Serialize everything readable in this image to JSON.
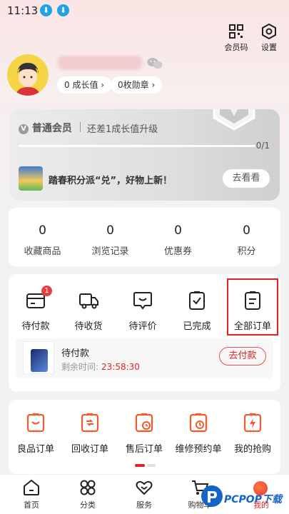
{
  "status_bar": {
    "time": "11:13"
  },
  "header": {
    "member_code_label": "会员码",
    "settings_label": "设置"
  },
  "profile": {
    "growth_chip": "0 成长值 ›",
    "medal_chip": "0枚勋章 ›"
  },
  "member_card": {
    "level": "普通会员",
    "upgrade_text": "还差1成长值升级",
    "progress_text": "0/1",
    "progress_value": 0,
    "promo_text": "踏春积分派“兑”，好物上新！",
    "promo_button": "去看看"
  },
  "stats": [
    {
      "value": "0",
      "label": "收藏商品"
    },
    {
      "value": "0",
      "label": "浏览记录"
    },
    {
      "value": "0",
      "label": "优惠券"
    },
    {
      "value": "0",
      "label": "积分"
    }
  ],
  "orders": {
    "items": [
      {
        "label": "待付款",
        "badge": "1",
        "icon": "wallet-icon"
      },
      {
        "label": "待收货",
        "icon": "truck-icon"
      },
      {
        "label": "待评价",
        "icon": "comment-icon"
      },
      {
        "label": "已完成",
        "icon": "check-clipboard-icon"
      },
      {
        "label": "全部订单",
        "icon": "list-clipboard-icon"
      }
    ],
    "pending": {
      "title": "待付款",
      "remaining_label": "剩余时间:",
      "remaining_time": "23:58:30",
      "pay_button": "去付款"
    }
  },
  "services": [
    {
      "label": "良品订单",
      "icon": "good-order-icon"
    },
    {
      "label": "回收订单",
      "icon": "recycle-order-icon"
    },
    {
      "label": "售后订单",
      "icon": "after-sale-icon"
    },
    {
      "label": "维修预约单",
      "icon": "repair-booking-icon"
    },
    {
      "label": "我的抢购",
      "icon": "flash-sale-icon"
    }
  ],
  "bottom_nav": [
    {
      "label": "首页",
      "icon": "home-icon"
    },
    {
      "label": "分类",
      "icon": "category-icon"
    },
    {
      "label": "服务",
      "icon": "heart-icon"
    },
    {
      "label": "购物车",
      "icon": "cart-icon"
    },
    {
      "label": "我的",
      "icon": "me-icon"
    }
  ],
  "watermark": {
    "text": "PCPOP下载"
  },
  "colors": {
    "accent": "#e02424",
    "badge": "#e83e3e",
    "service_icon": "#f05a28"
  }
}
